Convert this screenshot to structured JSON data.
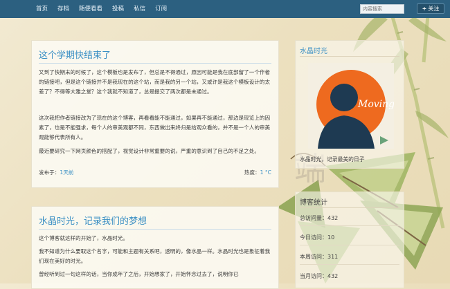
{
  "nav": {
    "items": [
      "首页",
      "存档",
      "随便看看",
      "投稿",
      "私信",
      "订阅"
    ]
  },
  "search": {
    "placeholder": "内容搜索"
  },
  "follow": {
    "plus": "+",
    "label": "关注"
  },
  "posts": [
    {
      "title": "这个学期快结束了",
      "paragraphs": [
        "又到了快期末的时候了，这个模板也是发布了，但总是不得通过，原因可能是我在底部留了一个作者的链接吧，但是这个链接并不是我现在的这个站，而是我的另一个站，又或许是我这个模板设计的太差了？不得等大雅之堂？这个我就不知道了，总是提交了两次都是未通过。",
        "这次我把作者链接改为了现在的这个博客，再看看能不能通过，如果再不能通过，那边是现览上的因素了，也是不能强求，每个人的审美观都不同，东西做出来终归是给观众看的，并不是一个人的审美观能够代表所有人。",
        "最近要研究一下网页颜色的搭配了，视觉设计非常重要的说，严重的意识到了自己的不足之处。"
      ],
      "published_label": "发布于：",
      "published_value": "1天前",
      "hot_label": "热度：",
      "hot_value": "1 °C"
    },
    {
      "title": "水晶时光，记录我们的梦想",
      "paragraphs": [
        "这个博客就这样的开始了，水晶时光。",
        "我不知道为什么要取这个名字，可能和主题有关系吧，透明的，像水晶一样。水晶时光也是象征着我们现在美好的时光。",
        "曾经听到过一句这样的话，当你成年了之后，开始想家了，开始怀念过去了，说明你已"
      ]
    }
  ],
  "sidebar": {
    "profile": {
      "title": "水晶时光",
      "avatar_text": "Moving",
      "caption": "水晶时光，记录最美的日子"
    },
    "stats": {
      "title": "博客统计",
      "rows": [
        "总访问量：432",
        "今日访问：10",
        "本周访问：311",
        "当月访问：432"
      ]
    }
  },
  "colors": {
    "topbar": "#2c6080",
    "accent": "#3a8fc4",
    "avatar_orange": "#ee6a1f",
    "avatar_navy": "#1e3a52"
  }
}
